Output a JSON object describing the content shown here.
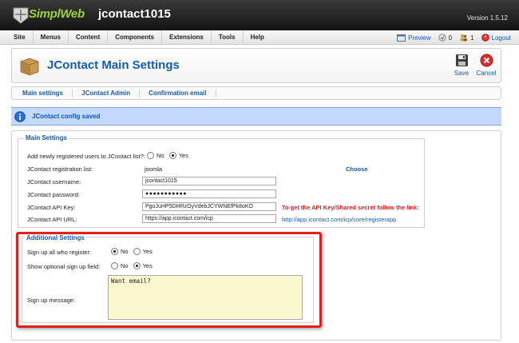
{
  "header": {
    "logo_text": "SimplWeb",
    "site_name": "jcontact1015",
    "version": "Version 1.5.12"
  },
  "menu": {
    "items": [
      "Site",
      "Menus",
      "Content",
      "Components",
      "Extensions",
      "Tools",
      "Help"
    ]
  },
  "status": {
    "preview": "Preview",
    "messages_count": "0",
    "users_count": "1",
    "logout": "Logout"
  },
  "toolbar": {
    "title": "JContact Main Settings",
    "save_label": "Save",
    "cancel_label": "Cancel"
  },
  "submenu": {
    "items": [
      "Main settings",
      "JContact Admin",
      "Confirmation email"
    ]
  },
  "message": {
    "text": "JContact config saved"
  },
  "main_settings": {
    "legend": "Main Settings",
    "add_users_label": "Add newly registered users to JContact list?:",
    "add_users_no": "No",
    "add_users_yes": "Yes",
    "add_users_selected": "Yes",
    "registration_list_label": "JContact registration list:",
    "registration_list_value": "joomla",
    "choose_link": "Choose",
    "username_label": "JContact username:",
    "username_value": "jcontact1015",
    "password_label": "JContact password:",
    "password_value": "●●●●●●●●●●●",
    "api_key_label": "JContact API Key:",
    "api_key_value": "PgoJuHP5DHRzOyVdebJCYWNEfPk8oKO",
    "api_key_note": "To get the API Key/Shared secret follow the link:",
    "api_url_label": "JContact API URL:",
    "api_url_value": "https://app.icontact.com/icp",
    "api_url_link": "http://app.icontact.com/icp/core/registerapp"
  },
  "additional_settings": {
    "legend": "Additional Settings",
    "signup_all_label": "Sign up all who register:",
    "signup_all_no": "No",
    "signup_all_yes": "Yes",
    "signup_all_selected": "No",
    "optional_field_label": "Show optional sign up field:",
    "optional_field_no": "No",
    "optional_field_yes": "Yes",
    "optional_field_selected": "Yes",
    "signup_message_label": "Sign up message:",
    "signup_message_value": "Want email?"
  },
  "colors": {
    "brand_green": "#9bd23c",
    "link_blue": "#135cae",
    "message_bg": "#c3d9ff",
    "highlight_red": "#e01f1f",
    "note_red": "#e02020",
    "textarea_bg": "#fbf7cf"
  },
  "icons": {
    "logo": "logo-badge-icon",
    "preview": "preview-icon",
    "messages": "messages-icon",
    "users": "users-icon",
    "logout": "logout-icon",
    "page": "package-box-icon",
    "save": "floppy-disk-icon",
    "cancel": "cancel-icon",
    "info": "info-icon"
  }
}
